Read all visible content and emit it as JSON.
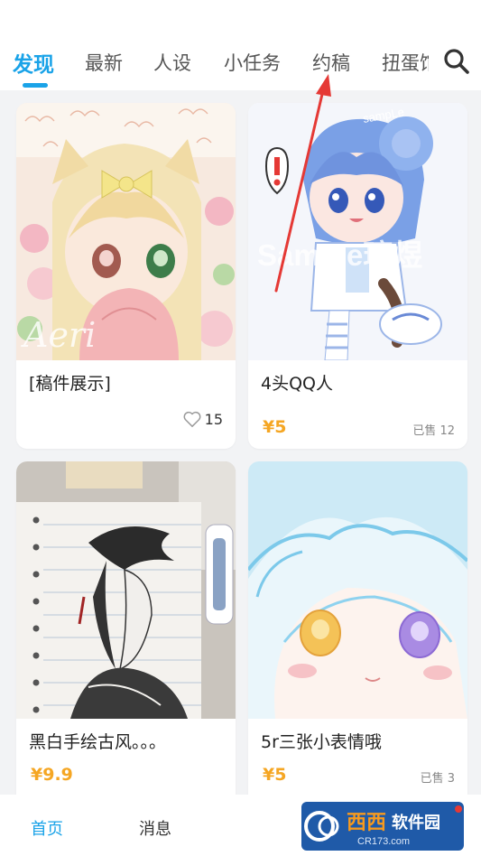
{
  "tabs": [
    {
      "label": "发现",
      "active": true
    },
    {
      "label": "最新"
    },
    {
      "label": "人设"
    },
    {
      "label": "小任务"
    },
    {
      "label": "约稿"
    },
    {
      "label": "扭蛋馆"
    }
  ],
  "cards": [
    {
      "title": "[稿件展示]",
      "likes": "15",
      "image_text": "Aeri"
    },
    {
      "title": "4头QQ人",
      "price": "¥5",
      "sold": "已售 12",
      "image_text": "Sample璃煜",
      "image_text_small": "sampLe"
    },
    {
      "title": "黑白手绘古风。。。",
      "price": "¥9.9"
    },
    {
      "title": "5r三张小表情哦",
      "price": "¥5",
      "sold": "已售 3"
    }
  ],
  "bottom_nav": {
    "home": "首页",
    "messages": "消息"
  },
  "watermark": {
    "brand": "西西",
    "label": "软件园",
    "url": "CR173.com"
  },
  "colors": {
    "accent": "#1aa3e8",
    "price": "#f5a623",
    "arrow": "#e53935"
  },
  "icons": {
    "search": "search-icon",
    "heart": "heart-outline-icon"
  }
}
